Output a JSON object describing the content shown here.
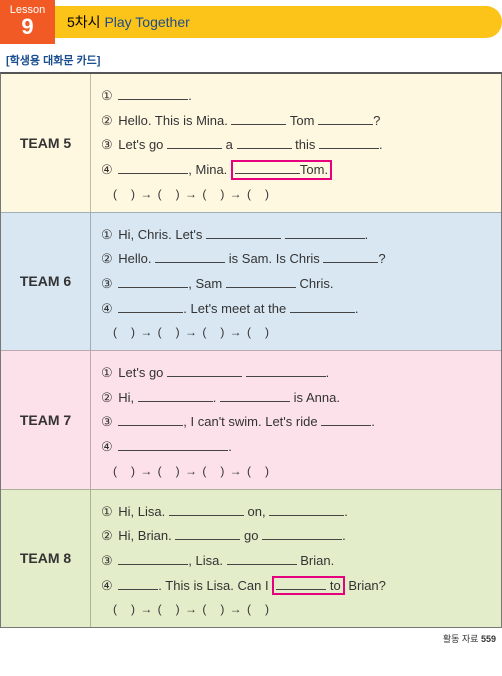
{
  "header": {
    "lesson_label": "Lesson",
    "lesson_num": "9",
    "period": "5차시",
    "title_en": "Play Together"
  },
  "subhead": "[학생용 대화문 카드]",
  "circled": [
    "①",
    "②",
    "③",
    "④"
  ],
  "seq": "( ) → ( ) → ( ) → ( )",
  "teams": {
    "t5": {
      "label": "TEAM 5",
      "l1_suffix": ".",
      "l2_a": "Hello. This is Mina.",
      "l2_b": "Tom",
      "l2_c": "?",
      "l3_a": "Let's go",
      "l3_b": "a",
      "l3_c": "this",
      "l3_d": ".",
      "l4_a": ", Mina.",
      "l4_b": "Tom."
    },
    "t6": {
      "label": "TEAM 6",
      "l1_a": "Hi, Chris. Let's",
      "l1_b": ".",
      "l2_a": "Hello.",
      "l2_b": "is Sam. Is Chris",
      "l2_c": "?",
      "l3_a": ", Sam",
      "l3_b": "Chris.",
      "l4_a": ". Let's meet at the",
      "l4_b": "."
    },
    "t7": {
      "label": "TEAM 7",
      "l1_a": "Let's go",
      "l1_b": ".",
      "l2_a": "Hi,",
      "l2_b": ".",
      "l2_c": "is Anna.",
      "l3_a": ", I can't swim. Let's ride",
      "l3_b": ".",
      "l4_a": "."
    },
    "t8": {
      "label": "TEAM 8",
      "l1_a": "Hi, Lisa.",
      "l1_b": "on,",
      "l1_c": ".",
      "l2_a": "Hi, Brian.",
      "l2_b": "go",
      "l2_c": ".",
      "l3_a": ", Lisa.",
      "l3_b": "Brian.",
      "l4_a": ". This is Lisa. Can I",
      "l4_b": "to",
      "l4_c": "Brian?"
    }
  },
  "footer": {
    "label": "활동 자료",
    "page": "559"
  }
}
